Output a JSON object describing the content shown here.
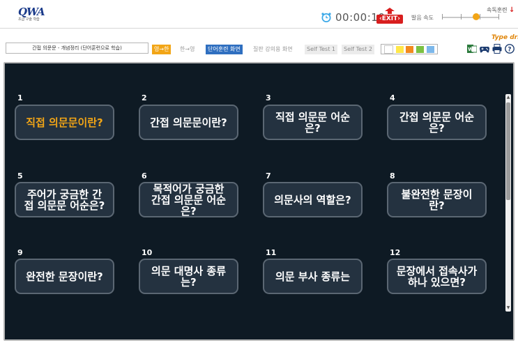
{
  "header": {
    "logo_text_a": "Q",
    "logo_text_b": "WA",
    "logo_subtext": "초급 구술 학습",
    "timer": "00:00:10",
    "exit_label": "EXIT",
    "speed_label": "발음 속도",
    "speed_level": 0.6,
    "word_training_label": "속독훈련",
    "word_training_arrow": "↓"
  },
  "toolbar": {
    "type_drill_label": "Type drill",
    "lesson_title": "간접 의문문 - 개념정리 (단어훈련으로 학습)",
    "lang_buttons": [
      {
        "label": "영→한",
        "style": "orange"
      },
      {
        "label": "한→영",
        "style": "gray"
      }
    ],
    "mode_buttons": [
      {
        "label": "단어훈련 화면",
        "style": "blue"
      },
      {
        "label": "질판 강의용 화면",
        "style": "gray"
      }
    ],
    "test_buttons": [
      {
        "label": "Self Test 1",
        "style": "gray-box"
      },
      {
        "label": "Self Test 2",
        "style": "gray-box"
      }
    ],
    "color_swatches": [
      "#ffffff",
      "#ffe74a",
      "#f28a1e",
      "#7bc142",
      "#7cb7ea"
    ],
    "tool_icons": [
      "word-export-icon",
      "gamepad-icon",
      "print-icon",
      "help-icon"
    ]
  },
  "cards": [
    {
      "num": "1",
      "label": "직접 의문문이란?",
      "active": true
    },
    {
      "num": "2",
      "label": "간접 의문문이란?",
      "active": false
    },
    {
      "num": "3",
      "label": "직접 의문문 어순은?",
      "active": false
    },
    {
      "num": "4",
      "label": "간접 의문문 어순은?",
      "active": false
    },
    {
      "num": "5",
      "label": "주어가 궁금한 간접 의문문 어순은?",
      "active": false
    },
    {
      "num": "6",
      "label": "목적어가 궁금한 간접 의문문 어순은?",
      "active": false
    },
    {
      "num": "7",
      "label": "의문사의 역할은?",
      "active": false
    },
    {
      "num": "8",
      "label": "불완전한 문장이란?",
      "active": false
    },
    {
      "num": "9",
      "label": "완전한 문장이란?",
      "active": false
    },
    {
      "num": "10",
      "label": "의문 대명사 종류는?",
      "active": false
    },
    {
      "num": "11",
      "label": "의문 부사 종류는",
      "active": false
    },
    {
      "num": "12",
      "label": "문장에서 접속사가 하나 있으면?",
      "active": false
    }
  ],
  "colors": {
    "board_bg": "#0e1a24",
    "card_bg": "#243240",
    "accent_orange": "#f2a516",
    "exit_red": "#d81e1e",
    "mode_blue": "#2f6fc0"
  }
}
